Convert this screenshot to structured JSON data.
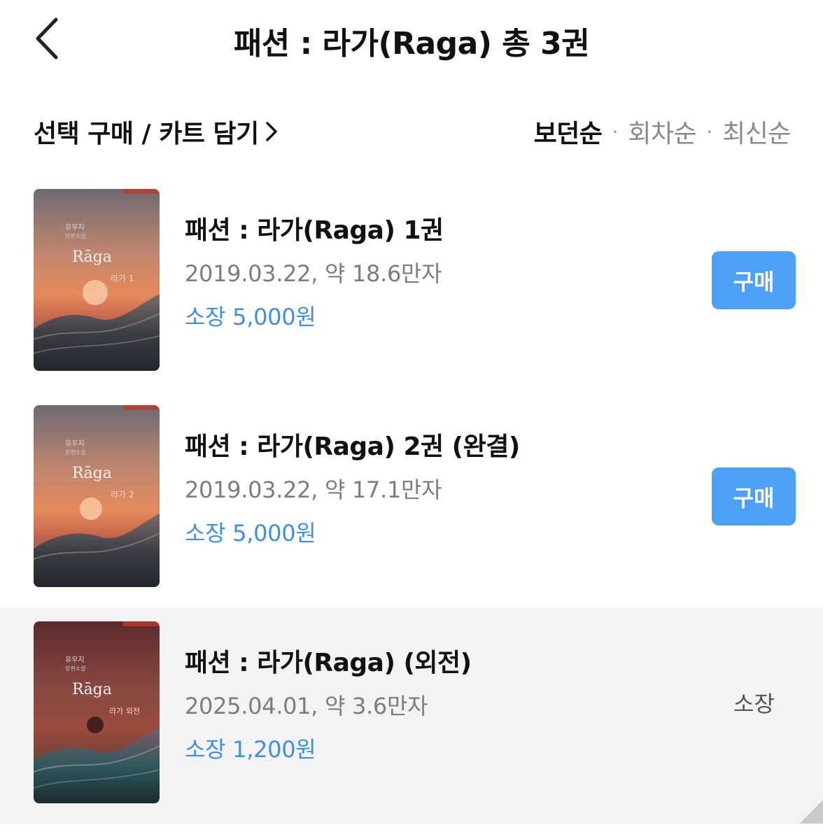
{
  "header": {
    "title": "패션 : 라가(Raga) 총 3권",
    "back_icon": "chevron-left-icon"
  },
  "toolbar": {
    "select_label": "선택 구매 / 카트 담기",
    "select_icon": "chevron-right-icon",
    "sort_options": [
      "보던순",
      "회차순",
      "최신순"
    ],
    "sort_active": "보던순"
  },
  "items": [
    {
      "title": "패션 : 라가(Raga) 1권",
      "meta": "2019.03.22, 약 18.6만자",
      "price": "소장 5,000원",
      "action": "구매",
      "cover": {
        "author": "유우지",
        "genre": "장편소설",
        "logo": "Rāga",
        "vol": "라가 1"
      }
    },
    {
      "title": "패션 : 라가(Raga) 2권 (완결)",
      "meta": "2019.03.22, 약 17.1만자",
      "price": "소장 5,000원",
      "action": "구매",
      "cover": {
        "author": "유우지",
        "genre": "장편소설",
        "logo": "Rāga",
        "vol": "라가 2"
      }
    },
    {
      "title": "패션 : 라가(Raga) (외전)",
      "meta": "2025.04.01, 약 3.6만자",
      "price": "소장 1,200원",
      "status": "소장",
      "cover": {
        "author": "유우지",
        "genre": "장편소설",
        "logo": "Rāga",
        "vol": "라가 외전"
      }
    }
  ],
  "colors": {
    "accent": "#4da0f5",
    "price": "#3f8fe6",
    "highlight_row": "#f3f3f3"
  }
}
